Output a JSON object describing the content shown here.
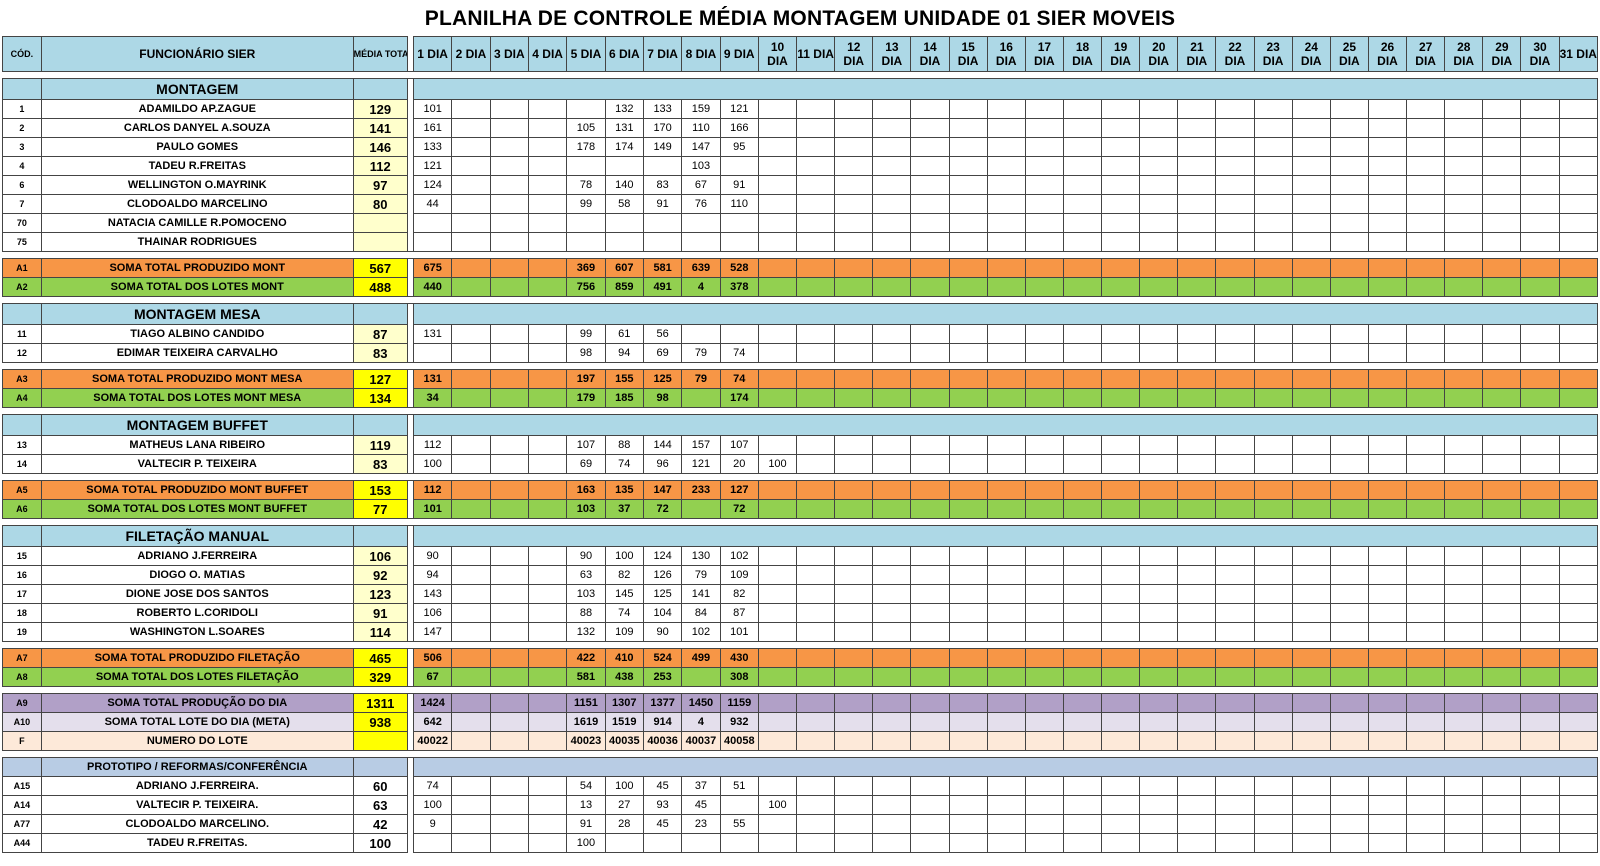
{
  "title": "PLANILHA DE CONTROLE MÉDIA MONTAGEM UNIDADE 01 SIER MOVEIS",
  "header": {
    "code": "CÓD.",
    "name": "FUNCIONÁRIO SIER",
    "media": "MÉDIA TOTAL",
    "days": [
      "1 DIA",
      "2 DIA",
      "3 DIA",
      "4 DIA",
      "5 DIA",
      "6 DIA",
      "7 DIA",
      "8 DIA",
      "9 DIA",
      "10 DIA",
      "11 DIA",
      "12 DIA",
      "13 DIA",
      "14 DIA",
      "15 DIA",
      "16 DIA",
      "17 DIA",
      "18 DIA",
      "19 DIA",
      "20 DIA",
      "21 DIA",
      "22 DIA",
      "23 DIA",
      "24 DIA",
      "25 DIA",
      "26 DIA",
      "27 DIA",
      "28 DIA",
      "29 DIA",
      "30 DIA",
      "31 DIA"
    ]
  },
  "rows": [
    {
      "type": "gap"
    },
    {
      "type": "section",
      "name": "MONTAGEM"
    },
    {
      "type": "emp",
      "code": "1",
      "name": "ADAMILDO AP.ZAGUE",
      "avg": "129",
      "days": {
        "1": "101",
        "6": "132",
        "7": "133",
        "8": "159",
        "9": "121"
      }
    },
    {
      "type": "emp",
      "code": "2",
      "name": "CARLOS DANYEL A.SOUZA",
      "avg": "141",
      "days": {
        "1": "161",
        "5": "105",
        "6": "131",
        "7": "170",
        "8": "110",
        "9": "166"
      }
    },
    {
      "type": "emp",
      "code": "3",
      "name": "PAULO GOMES",
      "avg": "146",
      "days": {
        "1": "133",
        "5": "178",
        "6": "174",
        "7": "149",
        "8": "147",
        "9": "95"
      }
    },
    {
      "type": "emp",
      "code": "4",
      "name": "TADEU R.FREITAS",
      "avg": "112",
      "days": {
        "1": "121",
        "8": "103"
      }
    },
    {
      "type": "emp",
      "code": "6",
      "name": "WELLINGTON O.MAYRINK",
      "avg": "97",
      "days": {
        "1": "124",
        "5": "78",
        "6": "140",
        "7": "83",
        "8": "67",
        "9": "91"
      }
    },
    {
      "type": "emp",
      "code": "7",
      "name": "CLODOALDO MARCELINO",
      "avg": "80",
      "days": {
        "1": "44",
        "5": "99",
        "6": "58",
        "7": "91",
        "8": "76",
        "9": "110"
      }
    },
    {
      "type": "emp",
      "code": "70",
      "name": "NATACIA CAMILLE R.POMOCENO",
      "avg": "",
      "days": {}
    },
    {
      "type": "emp",
      "code": "75",
      "name": "THAINAR RODRIGUES",
      "avg": "",
      "days": {}
    },
    {
      "type": "gap"
    },
    {
      "type": "orange",
      "code": "A1",
      "name": "SOMA TOTAL PRODUZIDO MONT",
      "avg": "567",
      "days": {
        "1": "675",
        "5": "369",
        "6": "607",
        "7": "581",
        "8": "639",
        "9": "528"
      }
    },
    {
      "type": "green",
      "code": "A2",
      "name": "SOMA TOTAL DOS LOTES MONT",
      "avg": "488",
      "days": {
        "1": "440",
        "5": "756",
        "6": "859",
        "7": "491",
        "8": "4",
        "9": "378"
      }
    },
    {
      "type": "gap"
    },
    {
      "type": "section",
      "name": "MONTAGEM MESA"
    },
    {
      "type": "emp",
      "code": "11",
      "name": "TIAGO ALBINO CANDIDO",
      "avg": "87",
      "days": {
        "1": "131",
        "5": "99",
        "6": "61",
        "7": "56"
      }
    },
    {
      "type": "emp",
      "code": "12",
      "name": "EDIMAR TEIXEIRA CARVALHO",
      "avg": "83",
      "days": {
        "5": "98",
        "6": "94",
        "7": "69",
        "8": "79",
        "9": "74"
      }
    },
    {
      "type": "gap"
    },
    {
      "type": "orange",
      "code": "A3",
      "name": "SOMA TOTAL PRODUZIDO MONT MESA",
      "avg": "127",
      "days": {
        "1": "131",
        "5": "197",
        "6": "155",
        "7": "125",
        "8": "79",
        "9": "74"
      }
    },
    {
      "type": "green",
      "code": "A4",
      "name": "SOMA TOTAL DOS LOTES MONT MESA",
      "avg": "134",
      "days": {
        "1": "34",
        "5": "179",
        "6": "185",
        "7": "98",
        "9": "174"
      }
    },
    {
      "type": "gap"
    },
    {
      "type": "section",
      "name": "MONTAGEM BUFFET"
    },
    {
      "type": "emp",
      "code": "13",
      "name": "MATHEUS LANA RIBEIRO",
      "avg": "119",
      "days": {
        "1": "112",
        "5": "107",
        "6": "88",
        "7": "144",
        "8": "157",
        "9": "107"
      }
    },
    {
      "type": "emp",
      "code": "14",
      "name": "VALTECIR P. TEIXEIRA",
      "avg": "83",
      "days": {
        "1": "100",
        "5": "69",
        "6": "74",
        "7": "96",
        "8": "121",
        "9": "20",
        "10": "100"
      }
    },
    {
      "type": "gap"
    },
    {
      "type": "orange",
      "code": "A5",
      "name": "SOMA TOTAL PRODUZIDO MONT BUFFET",
      "avg": "153",
      "days": {
        "1": "112",
        "5": "163",
        "6": "135",
        "7": "147",
        "8": "233",
        "9": "127"
      }
    },
    {
      "type": "green",
      "code": "A6",
      "name": "SOMA TOTAL DOS LOTES MONT BUFFET",
      "avg": "77",
      "days": {
        "1": "101",
        "5": "103",
        "6": "37",
        "7": "72",
        "9": "72"
      }
    },
    {
      "type": "gap"
    },
    {
      "type": "section",
      "name": "FILETAÇÃO MANUAL"
    },
    {
      "type": "emp",
      "code": "15",
      "name": "ADRIANO J.FERREIRA",
      "avg": "106",
      "days": {
        "1": "90",
        "5": "90",
        "6": "100",
        "7": "124",
        "8": "130",
        "9": "102"
      }
    },
    {
      "type": "emp",
      "code": "16",
      "name": "DIOGO O. MATIAS",
      "avg": "92",
      "days": {
        "1": "94",
        "5": "63",
        "6": "82",
        "7": "126",
        "8": "79",
        "9": "109"
      }
    },
    {
      "type": "emp",
      "code": "17",
      "name": "DIONE  JOSE DOS SANTOS",
      "avg": "123",
      "days": {
        "1": "143",
        "5": "103",
        "6": "145",
        "7": "125",
        "8": "141",
        "9": "82"
      }
    },
    {
      "type": "emp",
      "code": "18",
      "name": "ROBERTO L.CORIDOLI",
      "avg": "91",
      "days": {
        "1": "106",
        "5": "88",
        "6": "74",
        "7": "104",
        "8": "84",
        "9": "87"
      }
    },
    {
      "type": "emp",
      "code": "19",
      "name": "WASHINGTON L.SOARES",
      "avg": "114",
      "days": {
        "1": "147",
        "5": "132",
        "6": "109",
        "7": "90",
        "8": "102",
        "9": "101"
      }
    },
    {
      "type": "gap"
    },
    {
      "type": "orange",
      "code": "A7",
      "name": "SOMA TOTAL PRODUZIDO FILETAÇÃO",
      "avg": "465",
      "days": {
        "1": "506",
        "5": "422",
        "6": "410",
        "7": "524",
        "8": "499",
        "9": "430"
      }
    },
    {
      "type": "green",
      "code": "A8",
      "name": "SOMA TOTAL DOS LOTES FILETAÇÃO",
      "avg": "329",
      "days": {
        "1": "67",
        "5": "581",
        "6": "438",
        "7": "253",
        "9": "308"
      }
    },
    {
      "type": "gap"
    },
    {
      "type": "purple",
      "code": "A9",
      "name": "SOMA TOTAL PRODUÇÃO DO DIA",
      "avg": "1311",
      "days": {
        "1": "1424",
        "5": "1151",
        "6": "1307",
        "7": "1377",
        "8": "1450",
        "9": "1159"
      }
    },
    {
      "type": "lav",
      "code": "A10",
      "name": "SOMA TOTAL LOTE DO DIA (META)",
      "avg": "938",
      "days": {
        "1": "642",
        "5": "1619",
        "6": "1519",
        "7": "914",
        "8": "4",
        "9": "932"
      }
    },
    {
      "type": "peach",
      "code": "F",
      "name": "NUMERO DO LOTE",
      "avg": "",
      "days": {
        "1": "40022",
        "5": "40023",
        "6": "40035",
        "7": "40036",
        "8": "40037",
        "9": "40058"
      }
    },
    {
      "type": "gap"
    },
    {
      "type": "section2",
      "name": "PROTOTIPO / REFORMAS/CONFERÊNCIA"
    },
    {
      "type": "empw",
      "code": "A15",
      "name": "ADRIANO J.FERREIRA.",
      "avg": "60",
      "days": {
        "1": "74",
        "5": "54",
        "6": "100",
        "7": "45",
        "8": "37",
        "9": "51"
      }
    },
    {
      "type": "empw",
      "code": "A14",
      "name": "VALTECIR P. TEIXEIRA.",
      "avg": "63",
      "days": {
        "1": "100",
        "5": "13",
        "6": "27",
        "7": "93",
        "8": "45",
        "10": "100"
      }
    },
    {
      "type": "empw",
      "code": "A77",
      "name": "CLODOALDO MARCELINO.",
      "avg": "42",
      "days": {
        "1": "9",
        "5": "91",
        "6": "28",
        "7": "45",
        "8": "23",
        "9": "55"
      }
    },
    {
      "type": "empw",
      "code": "A44",
      "name": "TADEU R.FREITAS.",
      "avg": "100",
      "days": {
        "5": "100"
      }
    }
  ]
}
